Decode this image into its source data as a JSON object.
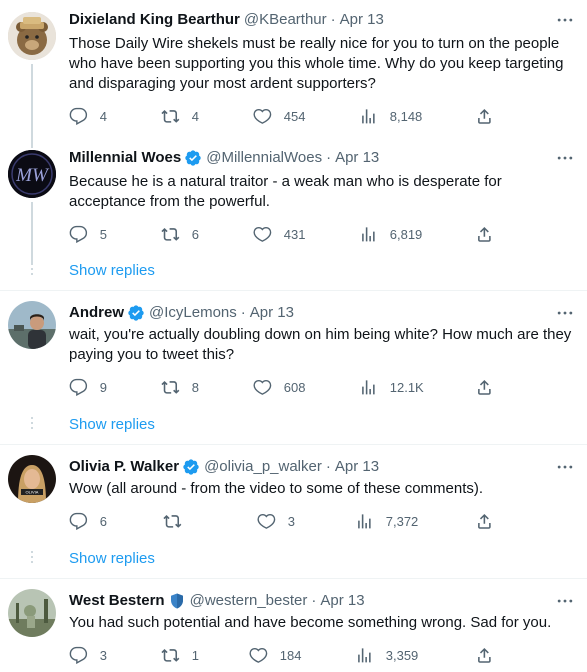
{
  "tweets": [
    {
      "name": "Dixieland King Bearthur",
      "handle": "@KBearthur",
      "dot": "·",
      "date": "Apr 13",
      "verified": "none",
      "text": "Those Daily Wire shekels must be really nice for you to turn on the people who have been supporting you this whole time. Why do you keep targeting and disparaging your most ardent supporters?",
      "replies": "4",
      "retweets": "4",
      "likes": "454",
      "views": "8,148"
    },
    {
      "name": "Millennial Woes",
      "handle": "@MillennialWoes",
      "dot": "·",
      "date": "Apr 13",
      "verified": "blue",
      "text": "Because he is a natural traitor - a weak man who is desperate for acceptance from the powerful.",
      "replies": "5",
      "retweets": "6",
      "likes": "431",
      "views": "6,819",
      "show_replies": "Show replies"
    },
    {
      "name": "Andrew",
      "handle": "@IcyLemons",
      "dot": "·",
      "date": "Apr 13",
      "verified": "blue",
      "text": "wait, you're actually doubling down on him being white? How much are they paying you to tweet this?",
      "replies": "9",
      "retweets": "8",
      "likes": "608",
      "views": "12.1K",
      "show_replies": "Show replies"
    },
    {
      "name": "Olivia P. Walker",
      "handle": "@olivia_p_walker",
      "dot": "·",
      "date": "Apr 13",
      "verified": "blue",
      "text": "Wow (all around - from the video to some of these comments).",
      "replies": "6",
      "retweets": "",
      "likes": "3",
      "views": "7,372",
      "show_replies": "Show replies"
    },
    {
      "name": "West Bestern",
      "handle": "@western_bester",
      "dot": "·",
      "date": "Apr 13",
      "verified": "shield",
      "text": "You had such potential and have become something wrong. Sad for you.",
      "replies": "3",
      "retweets": "1",
      "likes": "184",
      "views": "3,359"
    }
  ],
  "colors": {
    "text": "#0f1419",
    "secondary": "#536471",
    "accent": "#1d9bf0",
    "divider": "#eff3f4",
    "thread_line": "#cfd9de"
  },
  "icons": [
    "reply-icon",
    "retweet-icon",
    "like-icon",
    "views-icon",
    "share-icon",
    "more-icon",
    "verified-badge-icon",
    "shield-badge-icon"
  ]
}
